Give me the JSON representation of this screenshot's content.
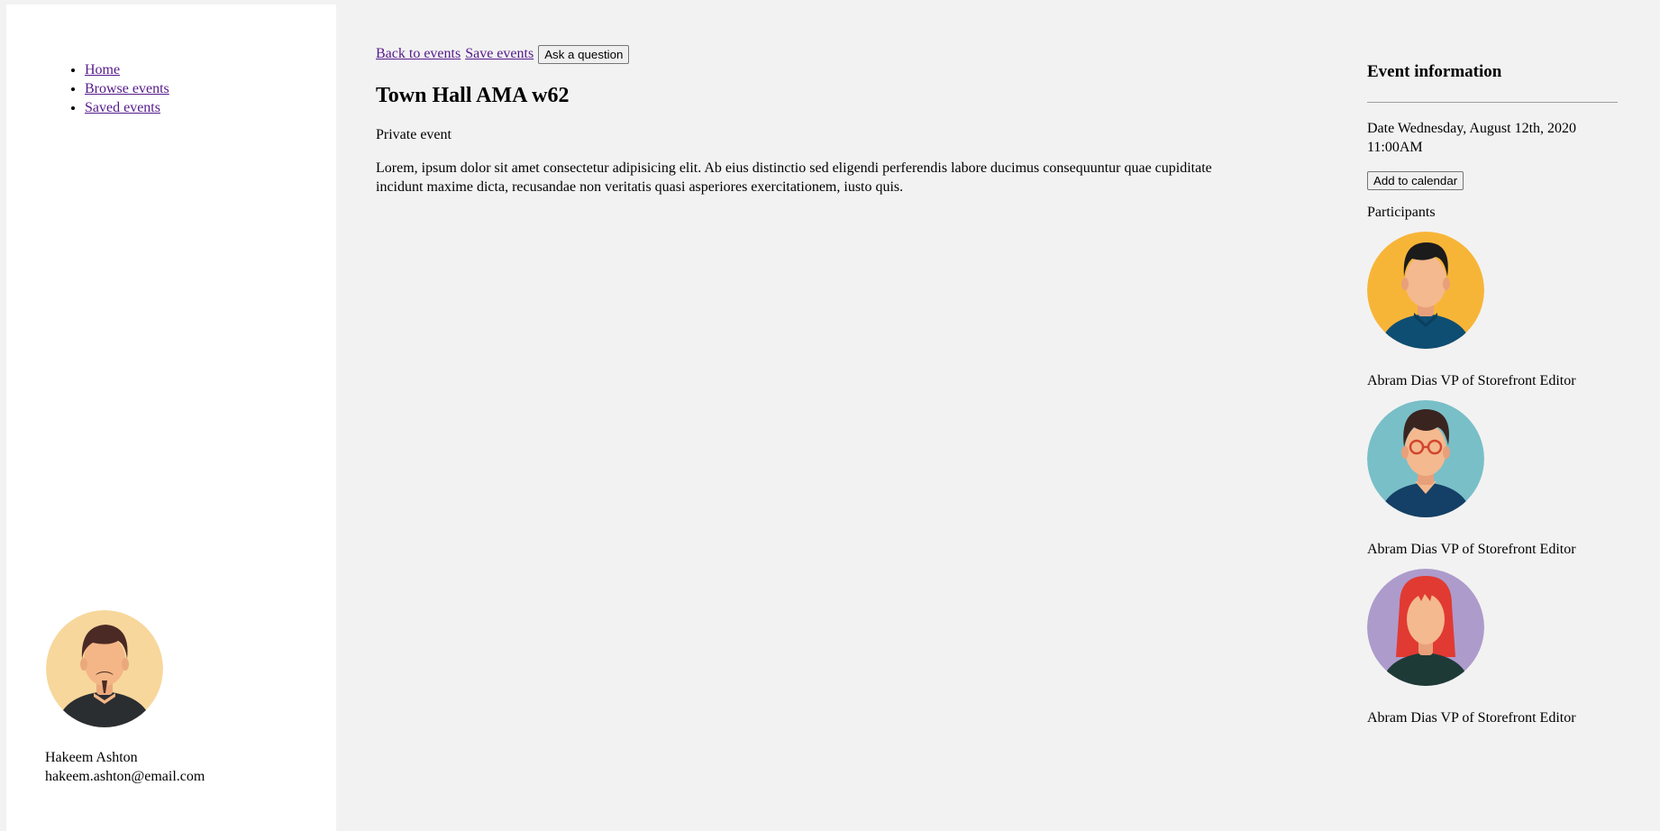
{
  "sidebar": {
    "nav": [
      {
        "label": "Home"
      },
      {
        "label": "Browse events"
      },
      {
        "label": "Saved events"
      }
    ],
    "user": {
      "name": "Hakeem Ashton",
      "email": "hakeem.ashton@email.com",
      "avatar_icon": "bearded-man-avatar-icon"
    }
  },
  "toolbar": {
    "back_label": "Back to events",
    "save_label": "Save events",
    "ask_label": "Ask a question"
  },
  "event": {
    "title": "Town Hall AMA w62",
    "type": "Private event",
    "description": "Lorem, ipsum dolor sit amet consectetur adipisicing elit. Ab eius distinctio sed eligendi perferendis labore ducimus consequuntur quae cupiditate incidunt maxime dicta, recusandae non veritatis quasi asperiores exercitationem, iusto quis."
  },
  "info": {
    "title": "Event information",
    "date_label": "Date",
    "date_value": "Wednesday, August 12th, 2020 11:00AM",
    "calendar_label": "Add to calendar",
    "participants_label": "Participants",
    "participants": [
      {
        "name": "Abram Dias",
        "role": "VP of Storefront Editor",
        "bg": "#f7b538"
      },
      {
        "name": "Abram Dias",
        "role": "VP of Storefront Editor",
        "bg": "#79bfc8"
      },
      {
        "name": "Abram Dias",
        "role": "VP of Storefront Editor",
        "bg": "#ad9bcc"
      }
    ]
  },
  "colors": {
    "page_bg": "#f2f2f2",
    "sidebar_bg": "#ffffff",
    "link": "#551a8b"
  }
}
